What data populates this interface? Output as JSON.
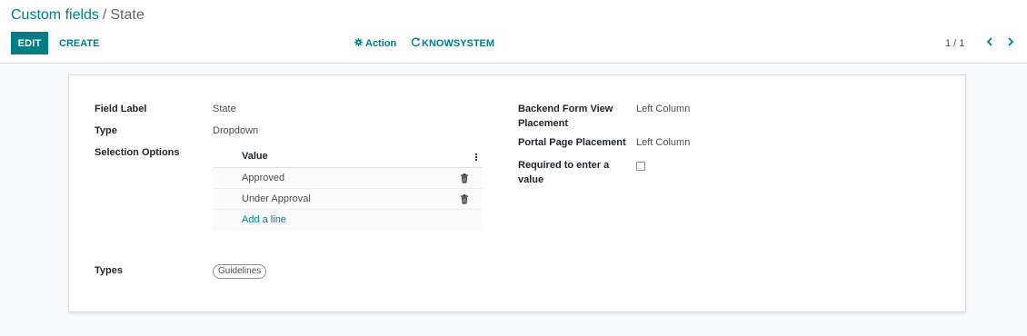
{
  "breadcrumb": {
    "parent": "Custom fields",
    "separator": "/",
    "current": "State"
  },
  "toolbar": {
    "edit_label": "EDIT",
    "create_label": "CREATE",
    "action_label": "Action",
    "action_icon": "gear-icon",
    "knowsystem_label": "KNOWSYSTEM",
    "knowsystem_icon": "refresh-icon"
  },
  "pager": {
    "value": "1 / 1",
    "prev_icon": "chevron-left-icon",
    "next_icon": "chevron-right-icon"
  },
  "form": {
    "field_label": {
      "label": "Field Label",
      "value": "State"
    },
    "type": {
      "label": "Type",
      "value": "Dropdown"
    },
    "selection_options": {
      "label": "Selection Options",
      "column_header": "Value",
      "rows": [
        {
          "value": "Approved"
        },
        {
          "value": "Under Approval"
        }
      ],
      "add_line_label": "Add a line"
    },
    "types": {
      "label": "Types",
      "tags": [
        "Guidelines"
      ]
    },
    "backend_form_view_placement": {
      "label_line1": "Backend Form View",
      "label_line2": "Placement",
      "value": "Left Column"
    },
    "portal_page_placement": {
      "label": "Portal Page Placement",
      "value": "Left Column"
    },
    "required": {
      "label_line1": "Required to enter a",
      "label_line2": "value",
      "checked": false
    }
  },
  "colors": {
    "accent": "#017e84",
    "text": "#212529",
    "muted": "#4c4c4c",
    "background": "#f9fafb"
  }
}
